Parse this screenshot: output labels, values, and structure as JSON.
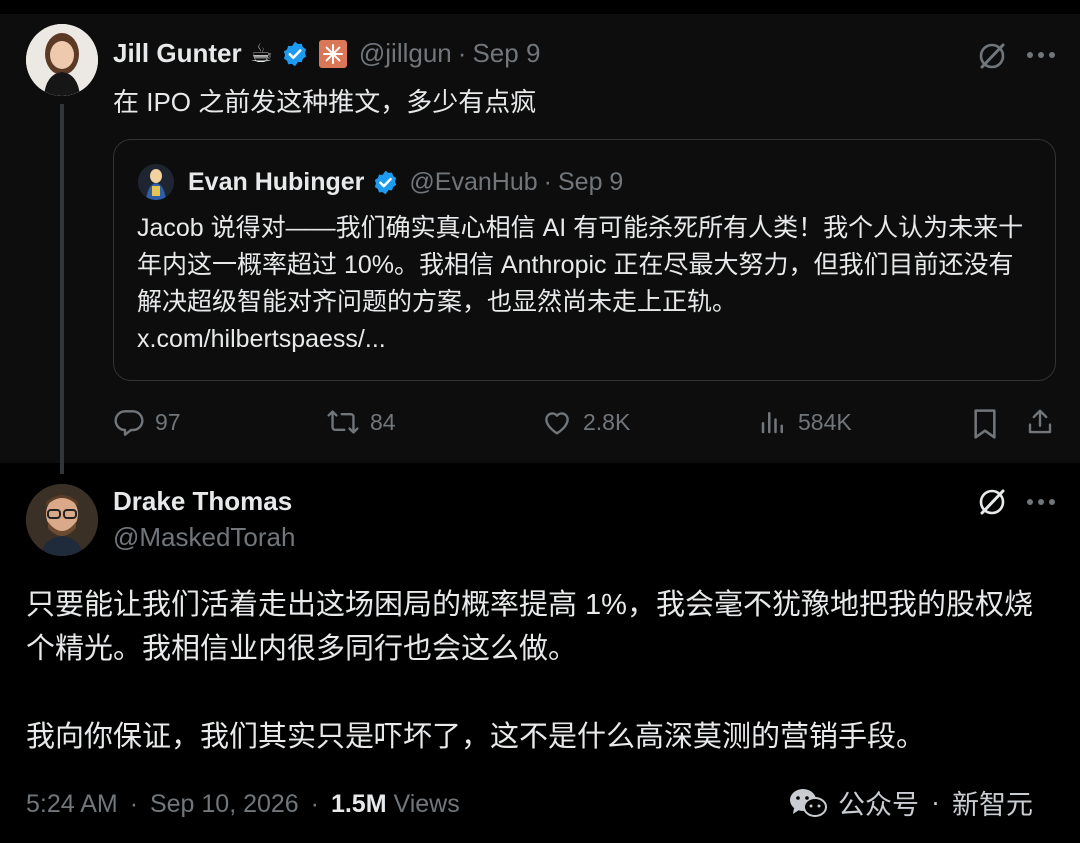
{
  "tweet1": {
    "author_name": "Jill Gunter",
    "handle": "@jillgun",
    "date": "Sep 9",
    "text": "在 IPO 之前发这种推文，多少有点疯",
    "quote": {
      "author_name": "Evan Hubinger",
      "handle": "@EvanHub",
      "date": "Sep 9",
      "text": "Jacob 说得对——我们确实真心相信 AI 有可能杀死所有人类！我个人认为未来十年内这一概率超过 10%。我相信 Anthropic 正在尽最大努力，但我们目前还没有解决超级智能对齐问题的方案，也显然尚未走上正轨。",
      "link": "x.com/hilbertspaess/..."
    },
    "actions": {
      "replies": "97",
      "reposts": "84",
      "likes": "2.8K",
      "views": "584K"
    }
  },
  "tweet2": {
    "author_name": "Drake Thomas",
    "handle": "@MaskedTorah",
    "paragraph1": "只要能让我们活着走出这场困局的概率提高 1%，我会毫不犹豫地把我的股权烧个精光。我相信业内很多同行也会这么做。",
    "paragraph2": "我向你保证，我们其实只是吓坏了，这不是什么高深莫测的营销手段。",
    "time": "5:24 AM",
    "full_date": "Sep 10, 2026",
    "views_count": "1.5M",
    "views_label": "Views"
  },
  "separator": "·",
  "watermark": {
    "label": "公众号",
    "brand": "新智元"
  },
  "colors": {
    "verified_blue": "#1d9bf0",
    "muted": "#71767b",
    "text": "#e7e9ea"
  }
}
